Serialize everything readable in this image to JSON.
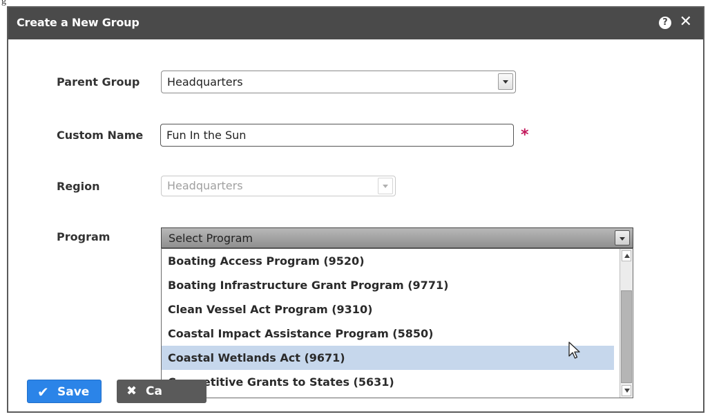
{
  "dialog": {
    "title": "Create a New Group",
    "help_icon": "question-icon",
    "close_icon": "close-icon"
  },
  "form": {
    "parent_group": {
      "label": "Parent Group",
      "value": "Headquarters"
    },
    "custom_name": {
      "label": "Custom Name",
      "value": "Fun In the Sun",
      "required_marker": "*"
    },
    "region": {
      "label": "Region",
      "value": "Headquarters",
      "disabled": true
    },
    "program": {
      "label": "Program",
      "value": "Select Program",
      "options": [
        "Boating Access Program (9520)",
        "Boating Infrastructure Grant Program (9771)",
        "Clean Vessel Act Program (9310)",
        "Coastal Impact Assistance Program (5850)",
        "Coastal Wetlands Act (9671)",
        "Competitive Grants to States (5631)"
      ],
      "hovered_option": "Coastal Wetlands Act (9671)"
    }
  },
  "buttons": {
    "save": "Save",
    "cancel": "Ca"
  },
  "colors": {
    "title_bar": "#4a4a4a",
    "save_button": "#2b84e8",
    "required": "#c2185b",
    "hover": "#c6d7ec"
  }
}
